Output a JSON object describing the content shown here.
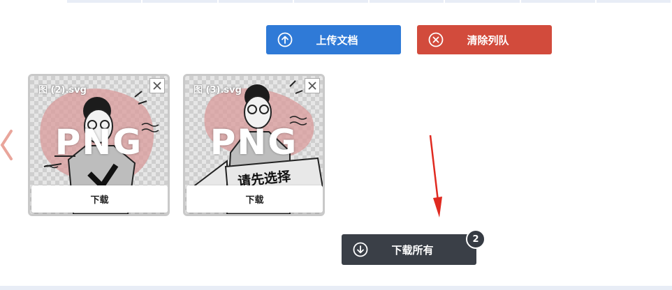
{
  "toolbar": {
    "upload_label": "上传文档",
    "clear_label": "清除列队"
  },
  "files": [
    {
      "name": "图 (2).svg",
      "format": "PNG",
      "download_label": "下载"
    },
    {
      "name": "图 (3).svg",
      "format": "PNG",
      "download_label": "下载",
      "art_text": "请先选择"
    }
  ],
  "download_all": {
    "label": "下载所有",
    "count": "2"
  },
  "colors": {
    "upload": "#2f7ad7",
    "clear": "#d24b3c",
    "download_all": "#3a3f47",
    "annotation_arrow": "#e02a20"
  },
  "icons": {
    "upload": "arrow-up-circle-icon",
    "clear": "x-circle-icon",
    "download_all": "arrow-down-circle-icon",
    "prev": "chevron-left-icon",
    "remove": "close-icon"
  }
}
